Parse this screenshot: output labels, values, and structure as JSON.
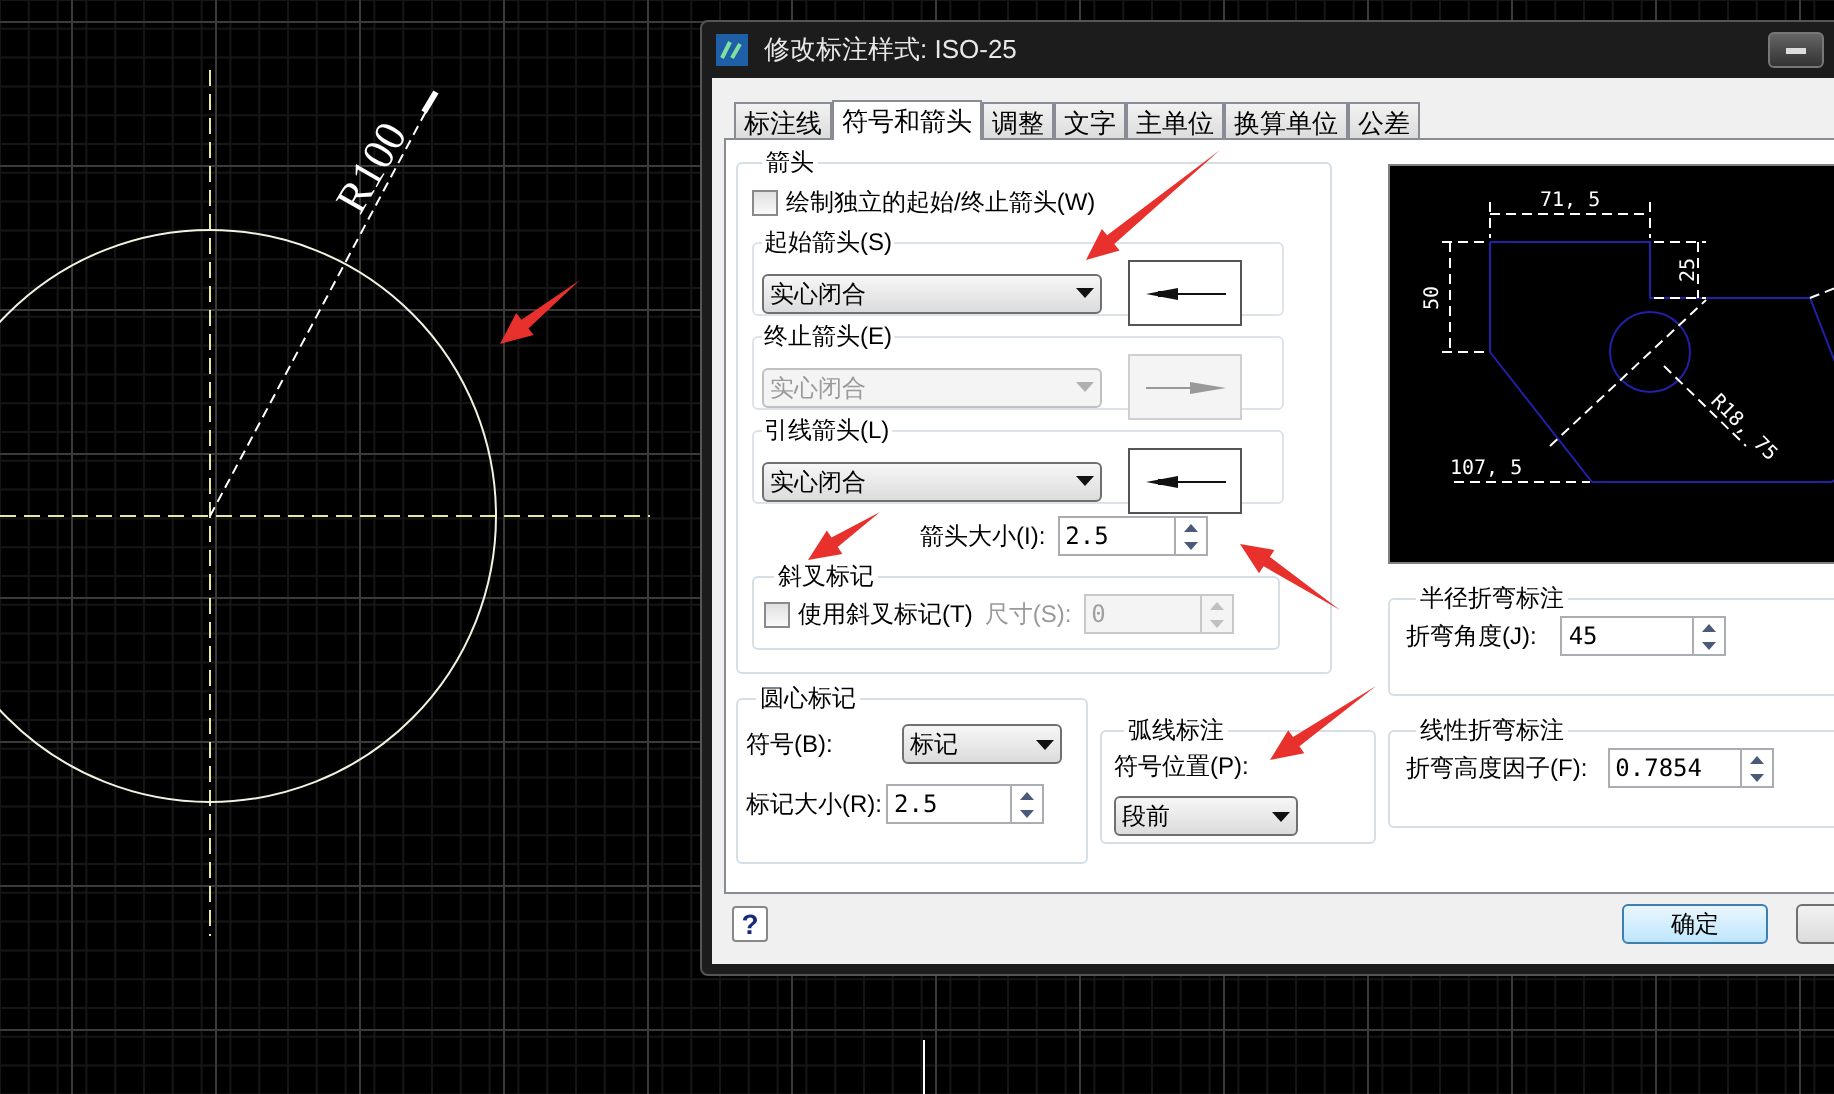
{
  "cad_canvas": {
    "dimension_label": "R100"
  },
  "dialog": {
    "title": "修改标注样式: ISO-25",
    "tabs": [
      {
        "label": "标注线",
        "selected": false
      },
      {
        "label": "符号和箭头",
        "selected": true
      },
      {
        "label": "调整",
        "selected": false
      },
      {
        "label": "文字",
        "selected": false
      },
      {
        "label": "主单位",
        "selected": false
      },
      {
        "label": "换算单位",
        "selected": false
      },
      {
        "label": "公差",
        "selected": false
      }
    ],
    "arrowheads": {
      "title": "箭头",
      "separate_checkbox": {
        "label": "绘制独立的起始/终止箭头(W)",
        "checked": false
      },
      "selectors": [
        {
          "label": "起始箭头(S)",
          "value": "实心闭合",
          "disabled": false
        },
        {
          "label": "终止箭头(E)",
          "value": "实心闭合",
          "disabled": true
        },
        {
          "label": "引线箭头(L)",
          "value": "实心闭合",
          "disabled": false
        }
      ],
      "size_label": "箭头大小(I):",
      "size_value": "2.5"
    },
    "oblique": {
      "title": "斜叉标记",
      "checkbox": {
        "label": "使用斜叉标记(T)",
        "checked": false
      },
      "size_label": "尺寸(S):",
      "size_value": "0",
      "size_disabled": true
    },
    "center_marks": {
      "title": "圆心标记",
      "symbol_label": "符号(B):",
      "symbol_value": "标记",
      "size_label": "标记大小(R):",
      "size_value": "2.5"
    },
    "arc_length": {
      "title": "弧线标注",
      "position_label": "符号位置(P):",
      "position_value": "段前"
    },
    "preview": {
      "labels": [
        "71, 5",
        "50",
        "25",
        "107, 5",
        "R18, 75"
      ]
    },
    "radius_jog": {
      "title": "半径折弯标注",
      "angle_label": "折弯角度(J):",
      "angle_value": "45"
    },
    "linear_jog": {
      "title": "线性折弯标注",
      "factor_label": "折弯高度因子(F):",
      "factor_value": "0.7854"
    },
    "help_button": "?",
    "ok_button": "确定"
  }
}
